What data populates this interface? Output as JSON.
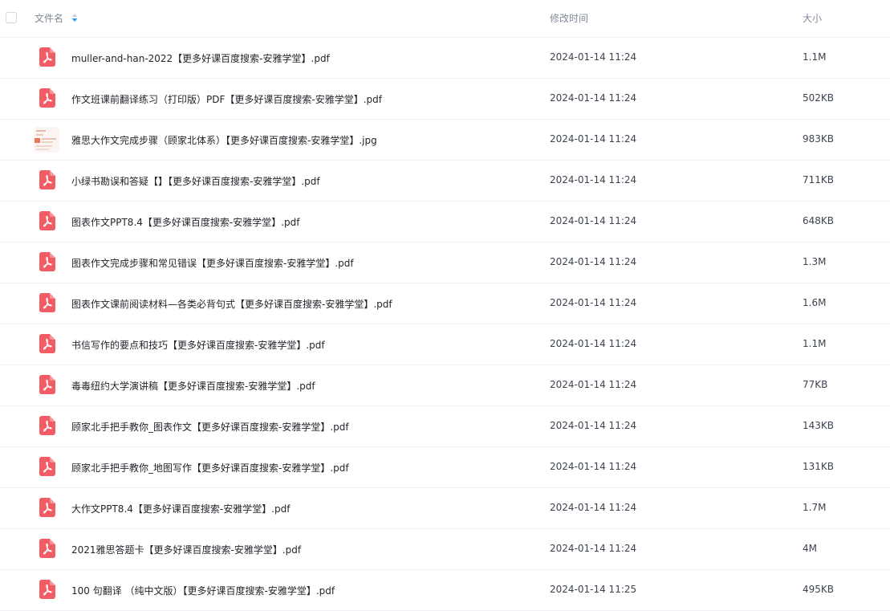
{
  "header": {
    "name_label": "文件名",
    "time_label": "修改时间",
    "size_label": "大小"
  },
  "colors": {
    "pdf_icon": "#f25c64",
    "sort_icon": "#2f9bf0"
  },
  "files": [
    {
      "name": "muller-and-han-2022【更多好课百度搜索-安雅学堂】.pdf",
      "time": "2024-01-14 11:24",
      "size": "1.1M",
      "type": "pdf"
    },
    {
      "name": "作文班课前翻译练习（打印版）PDF【更多好课百度搜索-安雅学堂】.pdf",
      "time": "2024-01-14 11:24",
      "size": "502KB",
      "type": "pdf"
    },
    {
      "name": "雅思大作文完成步骤（顾家北体系）【更多好课百度搜索-安雅学堂】.jpg",
      "time": "2024-01-14 11:24",
      "size": "983KB",
      "type": "jpg"
    },
    {
      "name": "小绿书勘误和答疑【】【更多好课百度搜索-安雅学堂】.pdf",
      "time": "2024-01-14 11:24",
      "size": "711KB",
      "type": "pdf"
    },
    {
      "name": "图表作文PPT8.4【更多好课百度搜索-安雅学堂】.pdf",
      "time": "2024-01-14 11:24",
      "size": "648KB",
      "type": "pdf"
    },
    {
      "name": "图表作文完成步骤和常见错误【更多好课百度搜索-安雅学堂】.pdf",
      "time": "2024-01-14 11:24",
      "size": "1.3M",
      "type": "pdf"
    },
    {
      "name": "图表作文课前阅读材料—各类必背句式【更多好课百度搜索-安雅学堂】.pdf",
      "time": "2024-01-14 11:24",
      "size": "1.6M",
      "type": "pdf"
    },
    {
      "name": "书信写作的要点和技巧【更多好课百度搜索-安雅学堂】.pdf",
      "time": "2024-01-14 11:24",
      "size": "1.1M",
      "type": "pdf"
    },
    {
      "name": "毒毒纽约大学演讲稿【更多好课百度搜索-安雅学堂】.pdf",
      "time": "2024-01-14 11:24",
      "size": "77KB",
      "type": "pdf"
    },
    {
      "name": "顾家北手把手教你_图表作文【更多好课百度搜索-安雅学堂】.pdf",
      "time": "2024-01-14 11:24",
      "size": "143KB",
      "type": "pdf"
    },
    {
      "name": "顾家北手把手教你_地图写作【更多好课百度搜索-安雅学堂】.pdf",
      "time": "2024-01-14 11:24",
      "size": "131KB",
      "type": "pdf"
    },
    {
      "name": "大作文PPT8.4【更多好课百度搜索-安雅学堂】.pdf",
      "time": "2024-01-14 11:24",
      "size": "1.7M",
      "type": "pdf"
    },
    {
      "name": "2021雅思答题卡【更多好课百度搜索-安雅学堂】.pdf",
      "time": "2024-01-14 11:24",
      "size": "4M",
      "type": "pdf"
    },
    {
      "name": "100 句翻译 （纯中文版）【更多好课百度搜索-安雅学堂】.pdf",
      "time": "2024-01-14 11:25",
      "size": "495KB",
      "type": "pdf"
    }
  ]
}
